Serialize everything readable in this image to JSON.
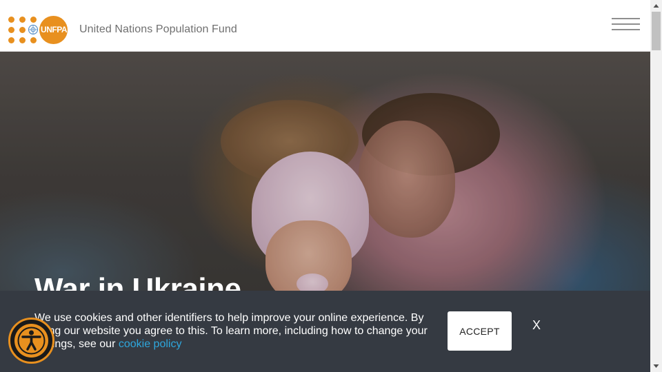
{
  "header": {
    "logo_text": "UNFPA",
    "org_name": "United Nations Population Fund",
    "menu_icon": "hamburger-menu-icon"
  },
  "hero": {
    "title": "War in Ukraine"
  },
  "cookie_banner": {
    "text": "We use cookies and other identifiers to help improve your online experience. By using our website you agree to this. To learn more, including how to change your settings, see our ",
    "link_text": "cookie policy",
    "accept_label": "ACCEPT",
    "close_label": "X"
  },
  "accessibility": {
    "icon": "accessibility-person-icon"
  },
  "colors": {
    "brand_orange": "#e8901f",
    "banner_bg": "#353a42",
    "link_blue": "#2ea7dd"
  }
}
